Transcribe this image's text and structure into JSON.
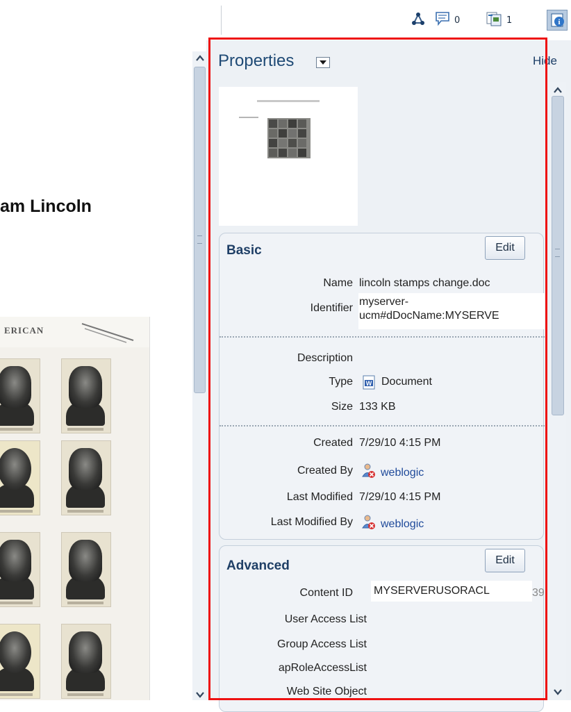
{
  "toolbar": {
    "comments_count": "0",
    "versions_count": "1"
  },
  "document": {
    "title_fragment": "am Lincoln",
    "sheet_banner": "ERICAN"
  },
  "panel": {
    "title": "Properties",
    "hide_label": "Hide"
  },
  "basic": {
    "title": "Basic",
    "edit_label": "Edit",
    "name_label": "Name",
    "name_value": "lincoln stamps change.doc",
    "identifier_label": "Identifier",
    "identifier_line1": "myserver-",
    "identifier_line2": "ucm#dDocName:MYSERVE",
    "description_label": "Description",
    "type_label": "Type",
    "type_value": "Document",
    "size_label": "Size",
    "size_value": "133 KB",
    "created_label": "Created",
    "created_value": "7/29/10 4:15 PM",
    "created_by_label": "Created By",
    "created_by_value": "weblogic",
    "last_modified_label": "Last Modified",
    "last_modified_value": "7/29/10 4:15 PM",
    "last_modified_by_label": "Last Modified By",
    "last_modified_by_value": "weblogic"
  },
  "advanced": {
    "title": "Advanced",
    "edit_label": "Edit",
    "content_id_label": "Content ID",
    "content_id_value": "MYSERVERUSORACL",
    "content_id_tail": "39",
    "user_access_label": "User Access List",
    "group_access_label": "Group Access List",
    "role_access_label": "apRoleAccessList",
    "web_site_object_label": "Web Site Object"
  },
  "colors": {
    "highlight": "#ee1111",
    "panel_title": "#1f4a75",
    "link": "#1f4a9a"
  }
}
